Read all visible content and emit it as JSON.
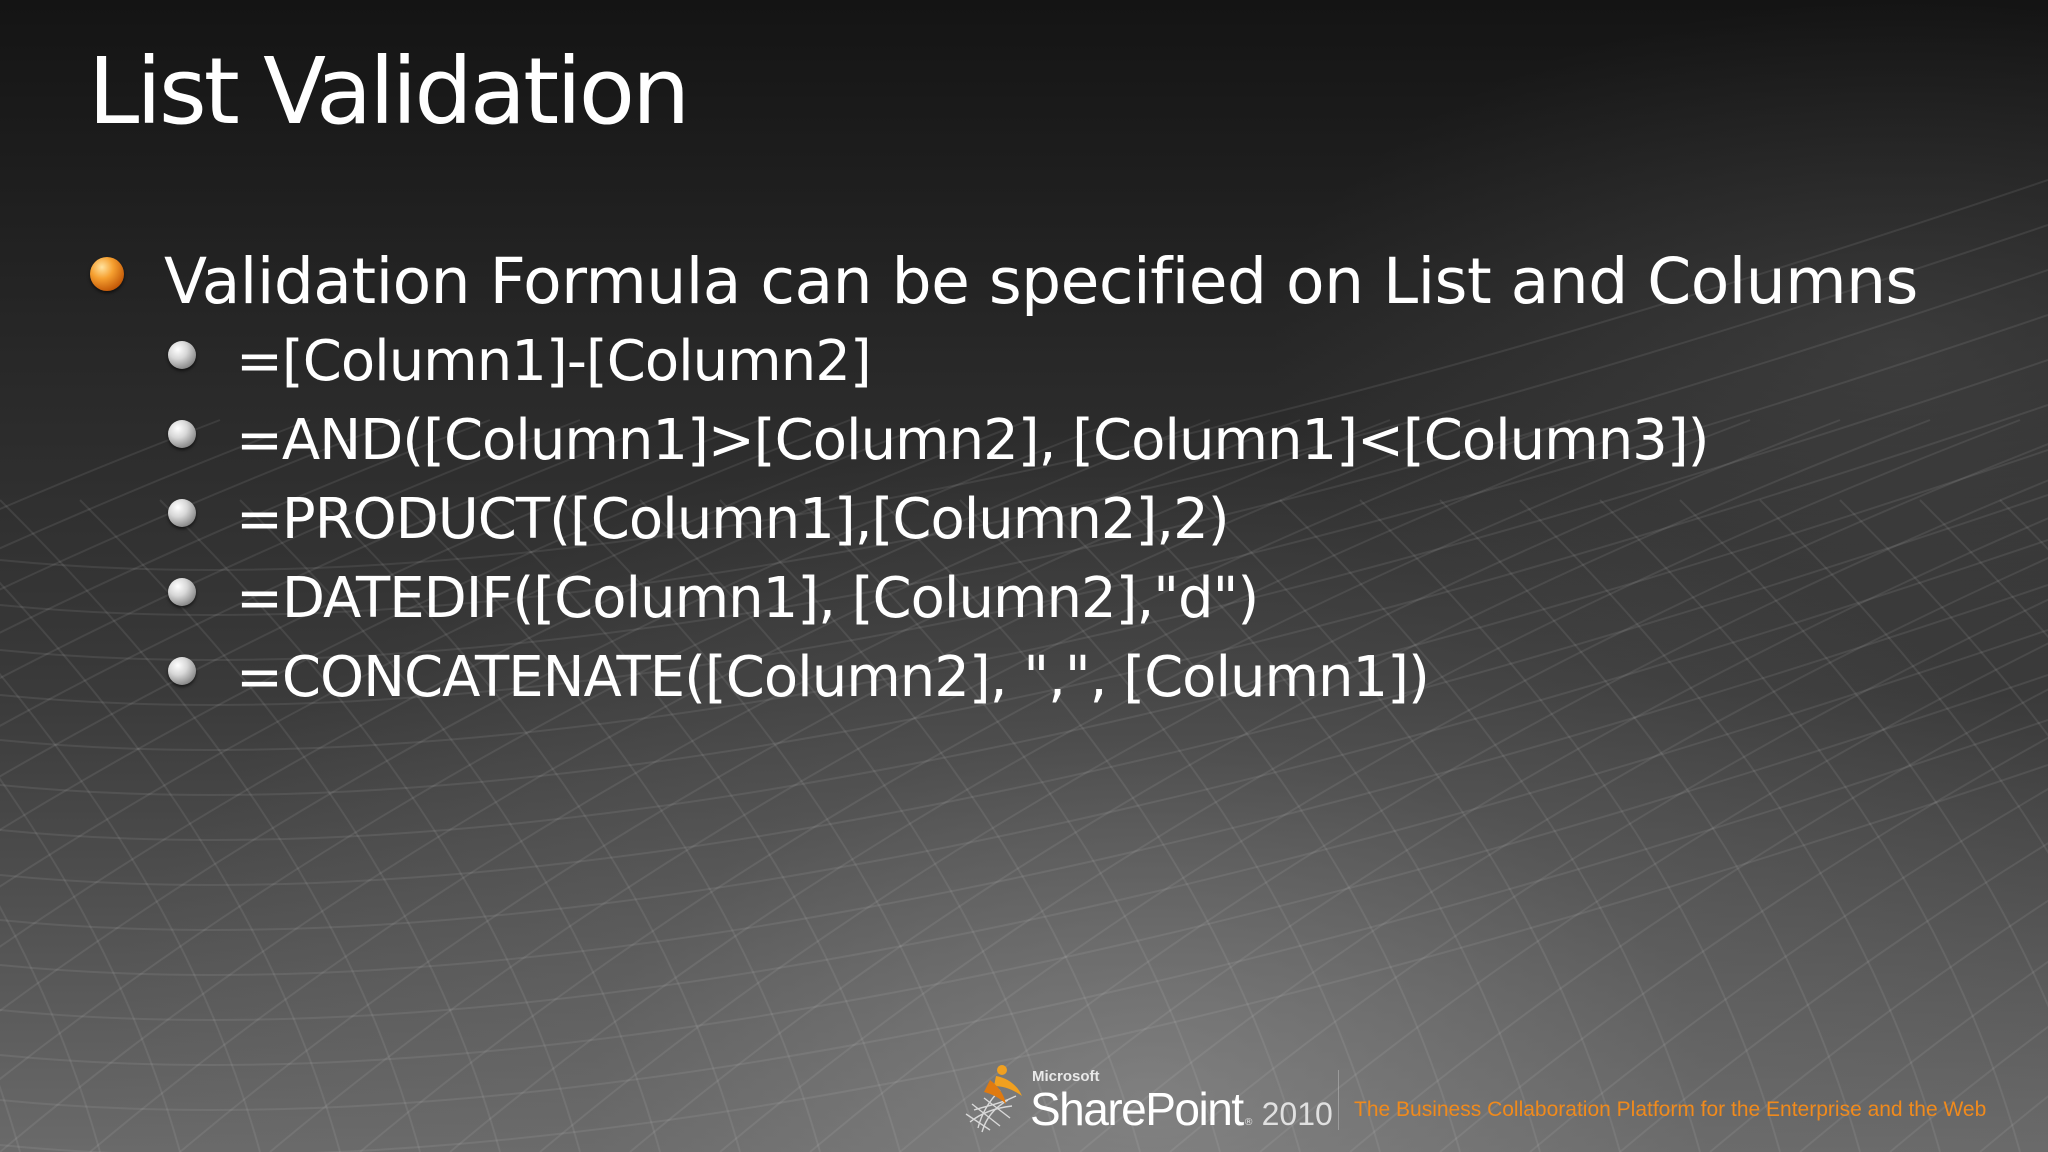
{
  "slide": {
    "title": "List Validation",
    "bullet": {
      "text": "Validation Formula can be specified on List and Columns",
      "subitems": [
        "=[Column1]-[Column2]",
        "=AND([Column1]>[Column2], [Column1]<[Column3])",
        "=PRODUCT([Column1],[Column2],2)",
        "=DATEDIF([Column1], [Column2],\"d\")",
        "=CONCATENATE([Column2], \",\", [Column1])"
      ]
    }
  },
  "footer": {
    "microsoft": "Microsoft",
    "product": "SharePoint",
    "trademark": "®",
    "year": "2010",
    "tagline": "The Business Collaboration Platform for the Enterprise and the Web"
  },
  "colors": {
    "tagline": "#f08a1c",
    "bullet_primary": "#e8891f",
    "bullet_secondary": "#c8c8c8"
  },
  "icons": {
    "primary_bullet": "orange-orb-icon",
    "secondary_bullet": "gray-orb-icon",
    "logo": "sharepoint-logo-icon"
  }
}
